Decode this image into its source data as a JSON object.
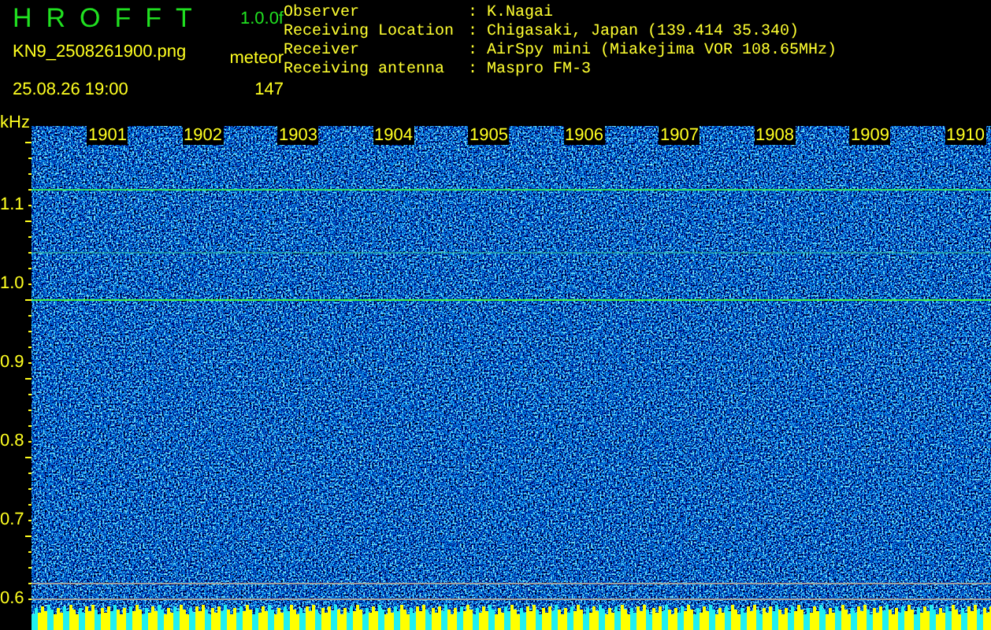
{
  "app": {
    "title": "HROFFT",
    "version": "1.0.0f",
    "filename": "KN9_2508261900.png",
    "timestamp": "25.08.26 19:00",
    "mode": "meteor",
    "count": "147"
  },
  "station": [
    {
      "label": "Observer",
      "value": ": K.Nagai"
    },
    {
      "label": "Receiving Location",
      "value": ": Chigasaki, Japan (139.414 35.340)"
    },
    {
      "label": "Receiver",
      "value": ": AirSpy mini (Miakejima VOR 108.65MHz)"
    },
    {
      "label": "Receiving antenna",
      "value": ": Maspro FM-3"
    }
  ],
  "plot": {
    "y_unit": "kHz",
    "time_labels": [
      "1901",
      "1902",
      "1903",
      "1904",
      "1905",
      "1906",
      "1907",
      "1908",
      "1909",
      "1910"
    ],
    "freq_labels": [
      "1.1",
      "1.0",
      "0.9",
      "0.8",
      "0.7",
      "0.6"
    ]
  }
}
